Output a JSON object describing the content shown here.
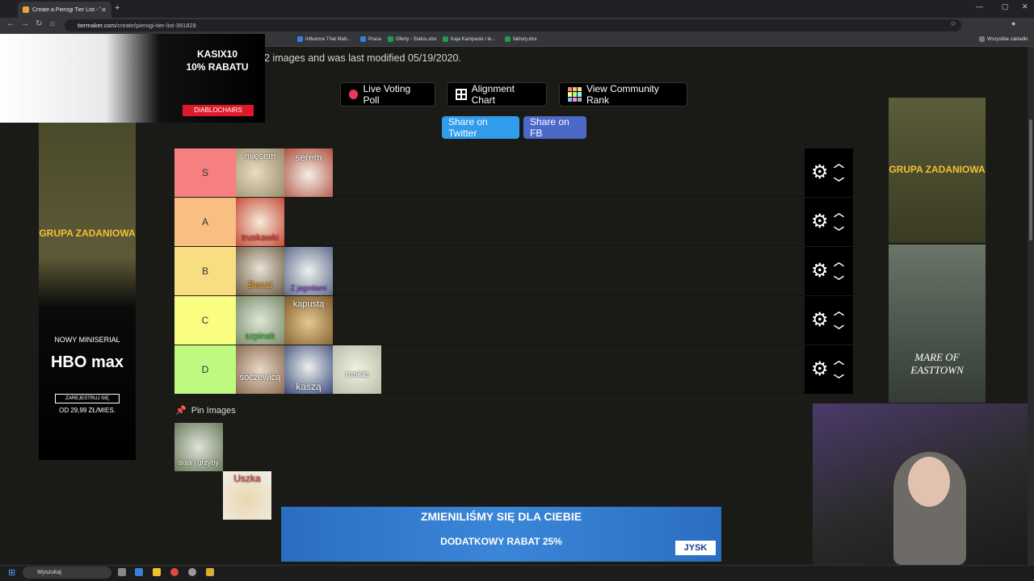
{
  "browser": {
    "tab_title": "Create a Pierogi Tier List - TierMaker",
    "url_host": "tiermaker.com",
    "url_path": "/create/pierogi-tier-list-391828",
    "bookmarks": [
      "Influence That Matt...",
      "Praca",
      "Oferty - Status.xlsx",
      "Kaja Kampanie i te...",
      "faktury.xlsx"
    ],
    "bookmarks_all": "Wszystkie zakładki"
  },
  "page": {
    "description": "2 images and was last modified 05/19/2020.",
    "buttons": {
      "live_voting": "Live Voting Poll",
      "alignment": "Alignment Chart",
      "community_rank": "View Community Rank",
      "share_twitter": "Share on Twitter",
      "share_fb": "Share on FB"
    },
    "pin_images": "Pin Images"
  },
  "tiers": [
    {
      "label": "S",
      "color": "#f67f7f",
      "items": [
        "mięsem",
        "serem"
      ]
    },
    {
      "label": "A",
      "color": "#f9bf80",
      "items": [
        "truskawki"
      ]
    },
    {
      "label": "B",
      "color": "#f8de80",
      "items": [
        "Baozi",
        "Z jagodami"
      ]
    },
    {
      "label": "C",
      "color": "#f9fe80",
      "items": [
        "szpinak",
        "kapustą"
      ]
    },
    {
      "label": "D",
      "color": "#bdfa7f",
      "items": [
        "soczewicą",
        "kaszą",
        "ruskie"
      ]
    }
  ],
  "pinned_items": [
    "soja i grzyby",
    "Uszka"
  ],
  "ads": {
    "top_code": "KASIX10",
    "top_discount": "10% RABATU",
    "top_brand": "DIABLOCHAIRS",
    "hbo_show": "GRUPA ZADANIOWA",
    "hbo_line1": "NOWY MINISERIAL",
    "hbo_brand": "HBO max",
    "hbo_cta": "ZAREJESTRUJ SIĘ",
    "hbo_price": "OD 29,99 ZŁ/MIES.",
    "right_show2": "MARE OF EASTTOWN",
    "bottom_head": "ZMIENILIŚMY SIĘ DLA CIEBIE",
    "bottom_sub": "DODATKOWY RABAT 25%",
    "bottom_brand": "JYSK"
  },
  "taskbar": {
    "search": "Wyszukaj"
  }
}
